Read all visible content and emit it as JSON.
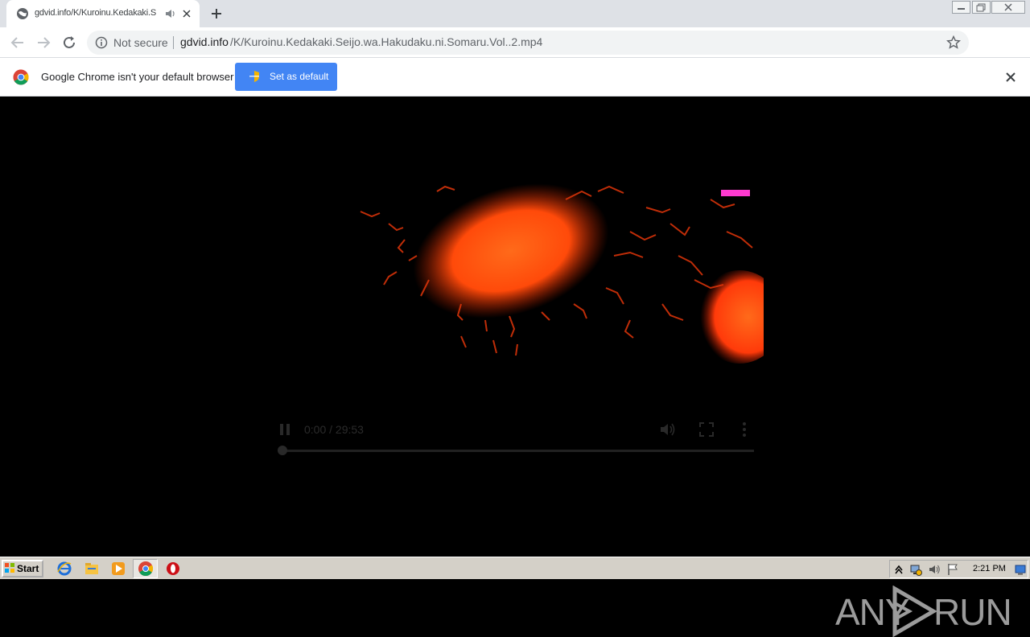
{
  "browser": {
    "tab_title": "gdvid.info/K/Kuroinu.Kedakaki.S",
    "url_security": "Not secure",
    "url_host": "gdvid.info",
    "url_path": "/K/Kuroinu.Kedakaki.Seijo.wa.Hakudaku.ni.Somaru.Vol..2.mp4"
  },
  "infobar": {
    "message": "Google Chrome isn't your default browser",
    "button_label": "Set as default"
  },
  "player": {
    "time_display": "0:00 / 29:53",
    "progress": 0.0
  },
  "watermark": {
    "left": "ANY",
    "right": "RUN"
  },
  "taskbar": {
    "start_label": "Start",
    "clock": "2:21 PM"
  },
  "colors": {
    "accent": "#4285f4",
    "tabstrip": "#dee1e6",
    "taskbar": "#d4d0c8"
  }
}
